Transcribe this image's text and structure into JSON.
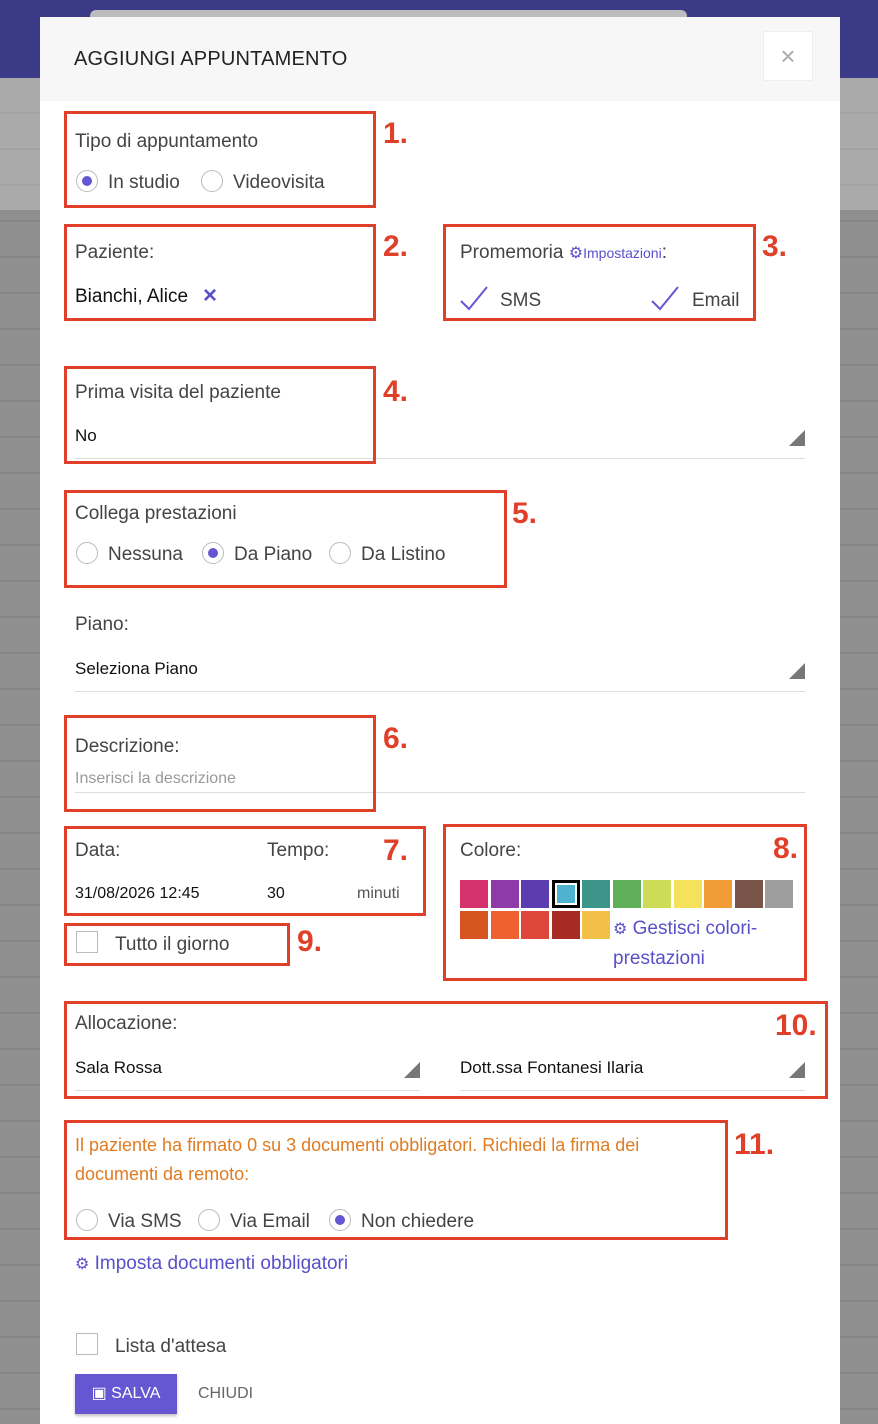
{
  "modal": {
    "title": "AGGIUNGI APPUNTAMENTO",
    "close_label": "×"
  },
  "tipo": {
    "label": "Tipo di appuntamento",
    "options": [
      "In studio",
      "Videovisita"
    ],
    "selected": "In studio"
  },
  "paziente": {
    "label": "Paziente:",
    "value": "Bianchi, Alice",
    "remove_icon": "×"
  },
  "promemoria": {
    "label": "Promemoria",
    "settings_link": "Impostazioni",
    "suffix": ":",
    "options": [
      "SMS",
      "Email"
    ]
  },
  "prima_visita": {
    "label": "Prima visita del paziente",
    "value": "No"
  },
  "collega": {
    "label": "Collega prestazioni",
    "options": [
      "Nessuna",
      "Da Piano",
      "Da Listino"
    ],
    "selected": "Da Piano"
  },
  "piano": {
    "label": "Piano:",
    "value": "Seleziona Piano"
  },
  "descrizione": {
    "label": "Descrizione:",
    "placeholder": "Inserisci la descrizione"
  },
  "data": {
    "label": "Data:",
    "value": "31/08/2026 12:45"
  },
  "tempo": {
    "label": "Tempo:",
    "value": "30",
    "unit": "minuti"
  },
  "tutto_giorno": {
    "label": "Tutto il giorno",
    "checked": false
  },
  "colore": {
    "label": "Colore:",
    "manage_link": "Gestisci colori-prestazioni",
    "selected_color": "#4fb3cf",
    "swatches_row1": [
      "#d6336c",
      "#8e3aa8",
      "#5b3db0",
      "#4fb3cf",
      "#3d9488",
      "#5fae58",
      "#cddc56",
      "#f4e35a",
      "#f29c38",
      "#795549",
      "#9e9e9e"
    ],
    "swatches_row2": [
      "#d5541f",
      "#ef6131",
      "#e0473b",
      "#a72b24",
      "#f2c046"
    ]
  },
  "allocazione": {
    "label": "Allocazione:",
    "room": "Sala Rossa",
    "doctor": "Dott.ssa Fontanesi Ilaria"
  },
  "firma": {
    "message": "Il paziente ha firmato 0 su 3 documenti obbligatori. Richiedi la firma dei documenti da remoto:",
    "options": [
      "Via SMS",
      "Via Email",
      "Non chiedere"
    ],
    "selected": "Non chiedere"
  },
  "imposta_link": "Imposta documenti obbligatori",
  "lista_attesa": {
    "label": "Lista d'attesa",
    "checked": false
  },
  "footer": {
    "save": "SALVA",
    "close": "CHIUDI"
  },
  "annotations": [
    "1.",
    "2.",
    "3.",
    "4.",
    "5.",
    "6.",
    "7.",
    "8.",
    "9.",
    "10.",
    "11."
  ],
  "colors": {
    "accent": "#6557d2",
    "annotation_red": "#e0402a",
    "warning_orange": "#e07b21"
  }
}
